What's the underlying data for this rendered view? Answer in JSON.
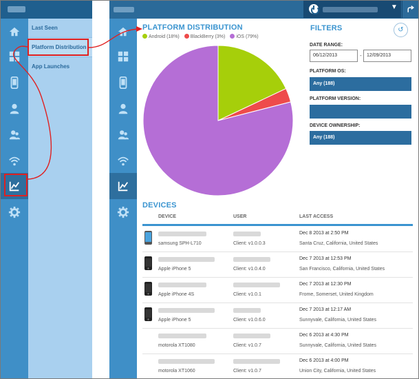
{
  "left_panel": {
    "submenu": [
      {
        "label": "Last Seen"
      },
      {
        "label": "Platform Distribution"
      },
      {
        "label": "App Launches"
      }
    ]
  },
  "right_app": {
    "rail_icons": [
      "home-icon",
      "dashboard-grid-icon",
      "mobile-device-icon",
      "user-icon",
      "users-icon",
      "wifi-icon",
      "analytics-chart-icon",
      "settings-gear-icon"
    ],
    "active_icon": "analytics-chart-icon"
  },
  "platform": {
    "title": "PLATFORM DISTRIBUTION",
    "legend": [
      {
        "label": "Android (18%)",
        "color": "#a6cf0a"
      },
      {
        "label": "BlackBerry (3%)",
        "color": "#ee4b4b"
      },
      {
        "label": "iOS (79%)",
        "color": "#b56ed6"
      }
    ]
  },
  "chart_data": {
    "type": "pie",
    "categories": [
      "Android",
      "BlackBerry",
      "iOS"
    ],
    "values": [
      18,
      3,
      79
    ],
    "colors": [
      "#a6cf0a",
      "#ee4b4b",
      "#b56ed6"
    ]
  },
  "filters": {
    "title": "FILTERS",
    "date_range_label": "DATE RANGE:",
    "date_from": "06/12/2013",
    "date_to": "12/09/2013",
    "date_separator": "-",
    "platform_os_label": "PLATFORM OS:",
    "platform_os_value": "Any (188)",
    "platform_version_label": "PLATFORM VERSION:",
    "platform_version_value": "",
    "device_ownership_label": "DEVICE OWNERSHIP:",
    "device_ownership_value": "Any (188)"
  },
  "devices": {
    "title": "DEVICES",
    "columns": [
      "DEVICE",
      "USER",
      "LAST ACCESS"
    ],
    "rows": [
      {
        "device": "samsung SPH-L710",
        "user": "Client: v1.0.0.3",
        "date": "Dec 8 2013 at 2:50 PM",
        "location": "Santa Cruz, California, United States",
        "phone": "android"
      },
      {
        "device": "Apple iPhone 5",
        "user": "Client: v1.0.4.0",
        "date": "Dec 7 2013 at 12:53 PM",
        "location": "San Francisco, California, United States",
        "phone": "iphone"
      },
      {
        "device": "Apple iPhone 4S",
        "user": "Client: v1.0.1",
        "date": "Dec 7 2013 at 12:30 PM",
        "location": "Frome, Somerset, United Kingdom",
        "phone": "iphone"
      },
      {
        "device": "Apple iPhone 5",
        "user": "Client: v1.0.6.0",
        "date": "Dec 7 2013 at 12:17 AM",
        "location": "Sunnyvale, California, United States",
        "phone": "iphone"
      },
      {
        "device": "motorola XT1080",
        "user": "Client: v1.0.7",
        "date": "Dec 6 2013 at 4:30 PM",
        "location": "Sunnyvale, California, United States",
        "phone": "none"
      },
      {
        "device": "motorola XT1060",
        "user": "Client: v1.0.7",
        "date": "Dec 6 2013 at 4:00 PM",
        "location": "Union City, California, United States",
        "phone": "none"
      }
    ]
  }
}
